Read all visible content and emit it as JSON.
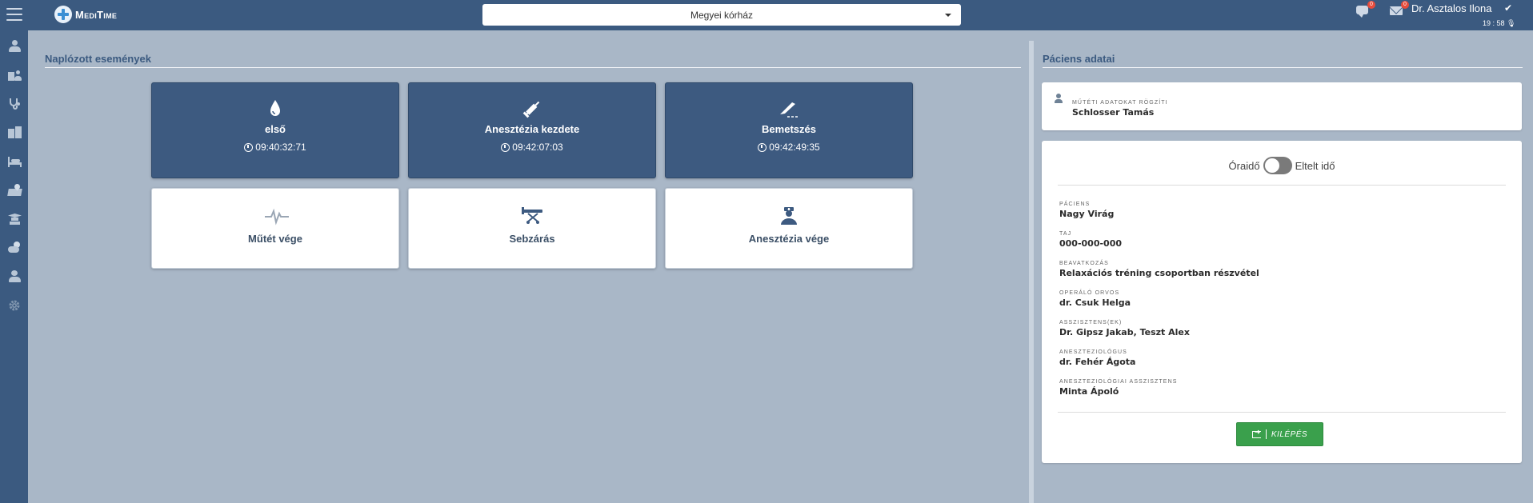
{
  "app": {
    "logo_text": "MediTime"
  },
  "header": {
    "hospital_select": "Megyei kórház",
    "chat_badge": "0",
    "mail_badge": "0",
    "user_name": "Dr. Asztalos Ilona",
    "clock": "19 : 58"
  },
  "sidebar": {
    "items": [
      {
        "icon": "doctor-icon"
      },
      {
        "icon": "patients-icon"
      },
      {
        "icon": "stethoscope-icon"
      },
      {
        "icon": "hospital-icon"
      },
      {
        "icon": "bed-icon"
      },
      {
        "icon": "map-location-icon"
      },
      {
        "icon": "education-icon"
      },
      {
        "icon": "weather-icon"
      },
      {
        "icon": "staff-icon"
      },
      {
        "icon": "settings-icon"
      }
    ]
  },
  "events": {
    "title": "Naplózott események",
    "logged": [
      {
        "label": "első",
        "time": "09:40:32:71",
        "icon": "drop-icon"
      },
      {
        "label": "Anesztézia kezdete",
        "time": "09:42:07:03",
        "icon": "syringe-icon"
      },
      {
        "label": "Bemetszés",
        "time": "09:42:49:35",
        "icon": "scalpel-icon"
      }
    ],
    "pending": [
      {
        "label": "Műtét vége",
        "icon": "heartbeat-icon"
      },
      {
        "label": "Sebzárás",
        "icon": "stretcher-icon"
      },
      {
        "label": "Anesztézia vége",
        "icon": "nurse-icon"
      }
    ]
  },
  "patient": {
    "title": "Páciens adatai",
    "recorder_label": "Műtéti adatokat rögzíti",
    "recorder_name": "Schlosser Tamás",
    "toggle_left": "Óraidő",
    "toggle_right": "Eltelt idő",
    "fields": [
      {
        "label": "Páciens",
        "value": "Nagy Virág"
      },
      {
        "label": "TAJ",
        "value": "000-000-000"
      },
      {
        "label": "Beavatkozás",
        "value": "Relaxációs tréning csoportban részvétel"
      },
      {
        "label": "Operáló orvos",
        "value": "dr. Csuk Helga"
      },
      {
        "label": "Asszisztens(ek)",
        "value": "Dr. Gipsz Jakab, Teszt Alex"
      },
      {
        "label": "Aneszteziológus",
        "value": "dr. Fehér Ágota"
      },
      {
        "label": "Aneszteziológiai asszisztens",
        "value": "Minta Ápoló"
      }
    ],
    "logout_label": "KILÉPÉS"
  },
  "colors": {
    "primary": "#3b5a80",
    "background": "#a9b7c7",
    "success": "#3aa04c"
  }
}
